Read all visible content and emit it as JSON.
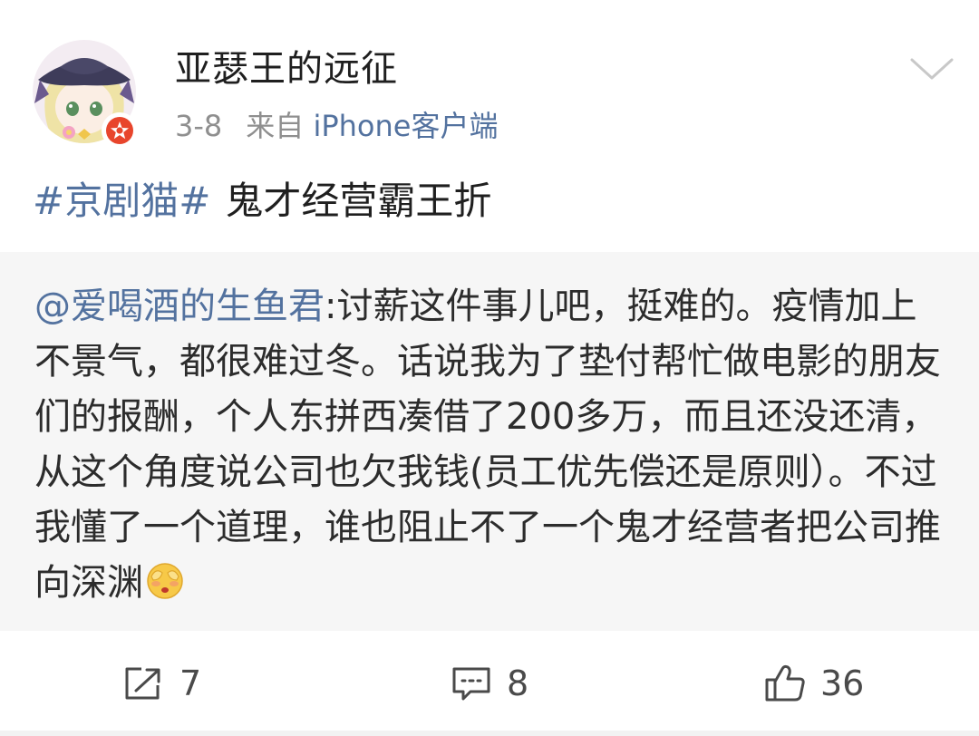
{
  "post": {
    "username": "亚瑟王的远征",
    "date": "3-8",
    "source_prefix": "来自",
    "source": "iPhone客户端",
    "topic": "#京剧猫#",
    "text": "鬼才经营霸王折"
  },
  "repost": {
    "mention": "@爱喝酒的生鱼君",
    "text": ":讨薪这件事儿吧，挺难的。疫情加上不景气，都很难过冬。话说我为了垫付帮忙做电影的朋友们的报酬，个人东拼西凑借了200多万，而且还没还清，从这个角度说公司也欠我钱(员工优先偿还是原则）。不过我懂了一个道理，谁也阻止不了一个鬼才经营者把公司推向深渊",
    "emoji": "shy-cover-face-emoji"
  },
  "actions": {
    "share_count": "7",
    "comment_count": "8",
    "like_count": "36"
  },
  "icons": {
    "share": "share-icon",
    "comment": "comment-icon",
    "like": "thumbs-up-icon",
    "menu": "chevron-down-icon",
    "badge": "weibo-verified-badge-icon"
  },
  "colors": {
    "link": "#53729f",
    "badge": "#e8452c",
    "repost_bg": "#f6f6f6"
  }
}
